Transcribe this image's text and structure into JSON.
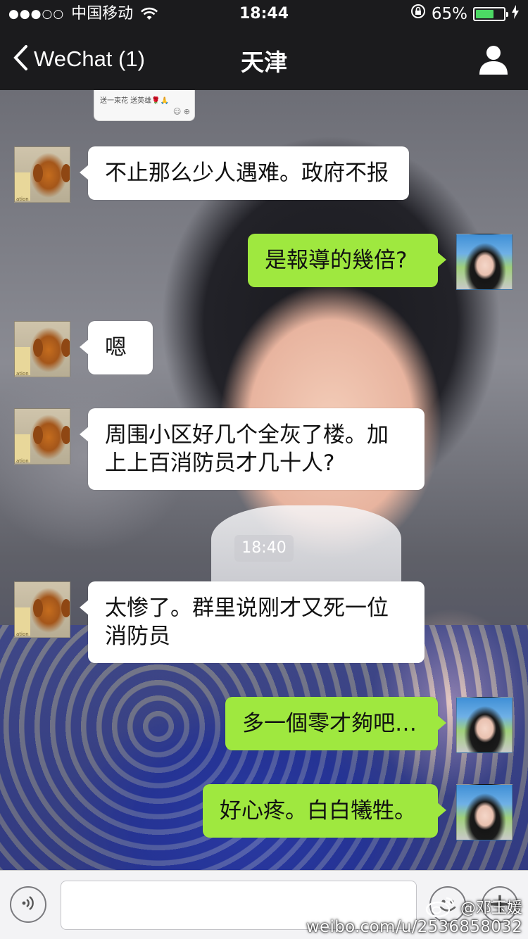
{
  "status_bar": {
    "signal": "●●●○○",
    "carrier": "中国移动",
    "time": "18:44",
    "battery_percent": "65%",
    "battery_level": 0.65
  },
  "nav": {
    "back_label": "WeChat (1)",
    "title": "天津",
    "profile_icon": "person-icon"
  },
  "thumbnail_snippet": {
    "text": "送一束花 送英雄🌹🙏"
  },
  "messages": [
    {
      "side": "in",
      "text": "不止那么少人遇难。政府不报"
    },
    {
      "side": "out",
      "text": "是報導的幾倍?"
    },
    {
      "side": "in",
      "text": "嗯"
    },
    {
      "side": "in",
      "text": "周围小区好几个全灰了楼。加上上百消防员才几十人?"
    },
    {
      "side": "in",
      "text": "太惨了。群里说刚才又死一位消防员"
    },
    {
      "side": "out",
      "text": "多一個零才夠吧…"
    },
    {
      "side": "out",
      "text": "好心疼。白白犧牲。"
    }
  ],
  "timestamp": "18:40",
  "input_bar": {
    "placeholder": "",
    "voice_icon": "voice-icon",
    "emoji_icon": "emoji-icon",
    "plus_label": "+"
  },
  "watermark": {
    "handle": "@邓玉媛",
    "url": "weibo.com/u/2536858032"
  },
  "colors": {
    "bar_bg": "#1b1b1d",
    "bubble_out": "#9fe83f",
    "bubble_in": "#ffffff",
    "battery": "#4cd964"
  }
}
